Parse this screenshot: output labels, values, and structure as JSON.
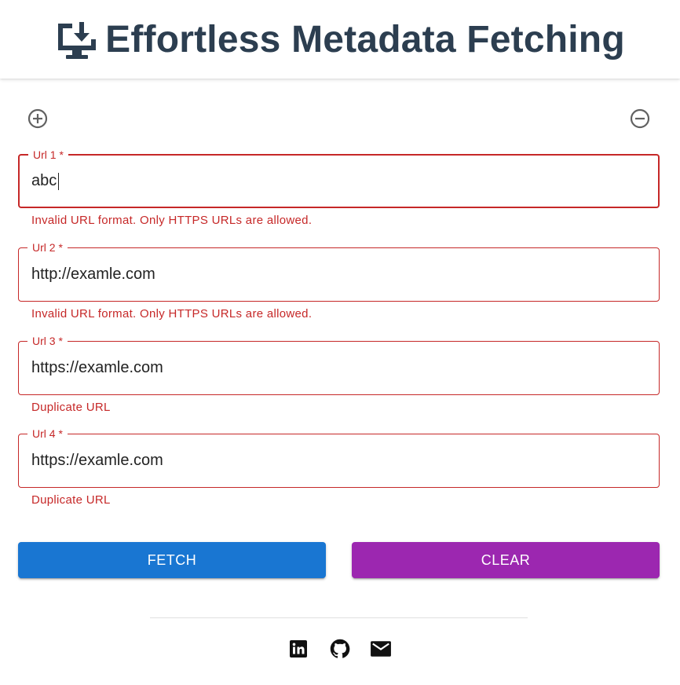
{
  "header": {
    "title": "Effortless Metadata Fetching",
    "icon": "download-to-desktop-icon",
    "title_color": "#2c3e50"
  },
  "controls": {
    "add_icon": "add-circle-outline-icon",
    "remove_icon": "remove-circle-outline-icon"
  },
  "fields": [
    {
      "label": "Url 1 *",
      "value": "abc",
      "error": "Invalid URL format. Only HTTPS URLs are allowed.",
      "focused": true
    },
    {
      "label": "Url 2 *",
      "value": "http://examle.com",
      "error": "Invalid URL format. Only HTTPS URLs are allowed."
    },
    {
      "label": "Url 3 *",
      "value": "https://examle.com",
      "error": "Duplicate URL"
    },
    {
      "label": "Url 4 *",
      "value": "https://examle.com",
      "error": "Duplicate URL"
    }
  ],
  "buttons": {
    "fetch_label": "FETCH",
    "clear_label": "CLEAR"
  },
  "footer": {
    "links": [
      {
        "icon": "linkedin-icon"
      },
      {
        "icon": "github-icon"
      },
      {
        "icon": "email-icon"
      }
    ]
  },
  "colors": {
    "error": "#c62828",
    "primary": "#1976d2",
    "secondary": "#9c27b0"
  }
}
